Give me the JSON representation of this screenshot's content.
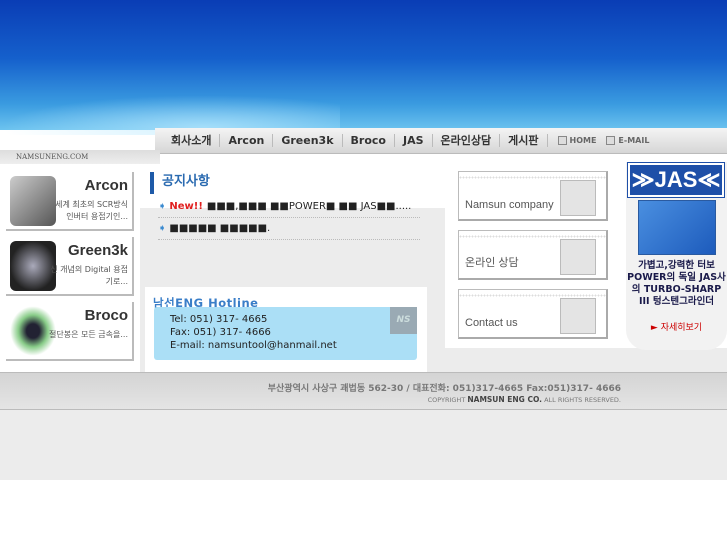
{
  "site": {
    "domain": "NAMSUNENG.COM"
  },
  "menu": {
    "items": [
      "회사소개",
      "Arcon",
      "Green3k",
      "Broco",
      "JAS",
      "온라인상담",
      "게시판"
    ],
    "home": "HOME",
    "email": "E-MAIL"
  },
  "products": [
    {
      "title": "Arcon",
      "desc": "세계 최초의 SCR방식 인버터 용접기인..."
    },
    {
      "title": "Green3k",
      "desc": "신 개념의 Digital 용접기로..."
    },
    {
      "title": "Broco",
      "desc": "절단봉은 모든 금속을..."
    }
  ],
  "notice": {
    "title": "공지사항",
    "items": [
      {
        "badge": "New!!",
        "text": "■■■,■■■ ■■POWER■ ■■ JAS■■....."
      },
      {
        "badge": "",
        "text": "■■■■■ ■■■■■."
      }
    ]
  },
  "hotline": {
    "title": "남선ENG Hotline",
    "tel": "Tel:   051) 317- 4665",
    "fax": "Fax:  051) 317- 4666",
    "email": "E-mail: namsuntool@hanmail.net",
    "logo": "NS"
  },
  "quick": [
    "Namsun company",
    "온라인 상담",
    "Contact us"
  ],
  "jas": {
    "logo": "≫JAS≪",
    "text": "가볍고,강력한 터보POWER의 독일 JAS사의 TURBO-SHARP III 텅스텐그라인더",
    "more": "► 자세히보기"
  },
  "footer": {
    "address": "부산광역시 사상구 괘법동 562-30 / 대표전화: 051)317-4665 Fax:051)317- 4666",
    "copy_pre": "COPYRIGHT ",
    "copy_name": "NAMSUN ENG CO.",
    "copy_post": " ALL RIGHTS RESERVED."
  },
  "colors": {
    "accent": "#1e5aa8",
    "hotline_bg": "#abdff6",
    "new": "#e02020"
  }
}
